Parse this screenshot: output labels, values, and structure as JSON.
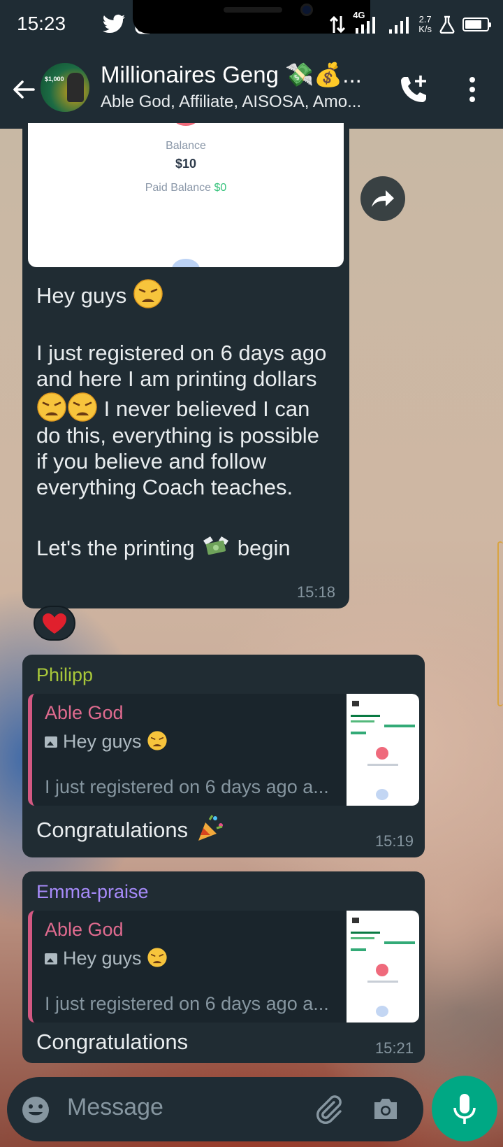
{
  "status_bar": {
    "time": "15:23",
    "network": "4G",
    "speed_value": "2.7",
    "speed_unit": "K/s",
    "battery_level": 0.75,
    "icons": [
      "twitter-icon",
      "instagram-icon",
      "dot-icon",
      "data-arrows-icon",
      "signal-icon",
      "lab-icon",
      "battery-icon"
    ]
  },
  "header": {
    "title": "Millionaires Geng 💸💰...",
    "subtitle": "Able God, Affiliate, AISOSA, Amo...",
    "avatar_text": "$1,000"
  },
  "messages": [
    {
      "image": {
        "balance_label": "Balance",
        "balance_value": "$10",
        "paid_label": "Paid Balance",
        "paid_value": "$0"
      },
      "lines": [
        "Hey guys",
        "I just registered on 6 days ago",
        "and here I am printing dollars",
        "I never believed I can",
        "do this, everything is possible",
        "if you believe and follow",
        "everything Coach teaches.",
        "Let's the printing",
        "begin"
      ],
      "time": "15:18",
      "reaction": "❤️"
    },
    {
      "sender": "Philipp",
      "sender_color": "#a8c73a",
      "quote": {
        "author": "Able God",
        "line1": "Hey guys",
        "line2": "I just registered on 6 days ago a..."
      },
      "text": "Congratulations",
      "time": "15:19"
    },
    {
      "sender": "Emma-praise",
      "sender_color": "#a78bfa",
      "quote": {
        "author": "Able God",
        "line1": "Hey guys",
        "line2": "I just registered on 6 days ago a..."
      },
      "text": "Congratulations",
      "time": "15:21"
    }
  ],
  "composer": {
    "placeholder": "Message"
  },
  "colors": {
    "accent": "#00a884",
    "bubble": "#202c33",
    "header": "#1f2c34",
    "quote_bar": "#d35882"
  }
}
